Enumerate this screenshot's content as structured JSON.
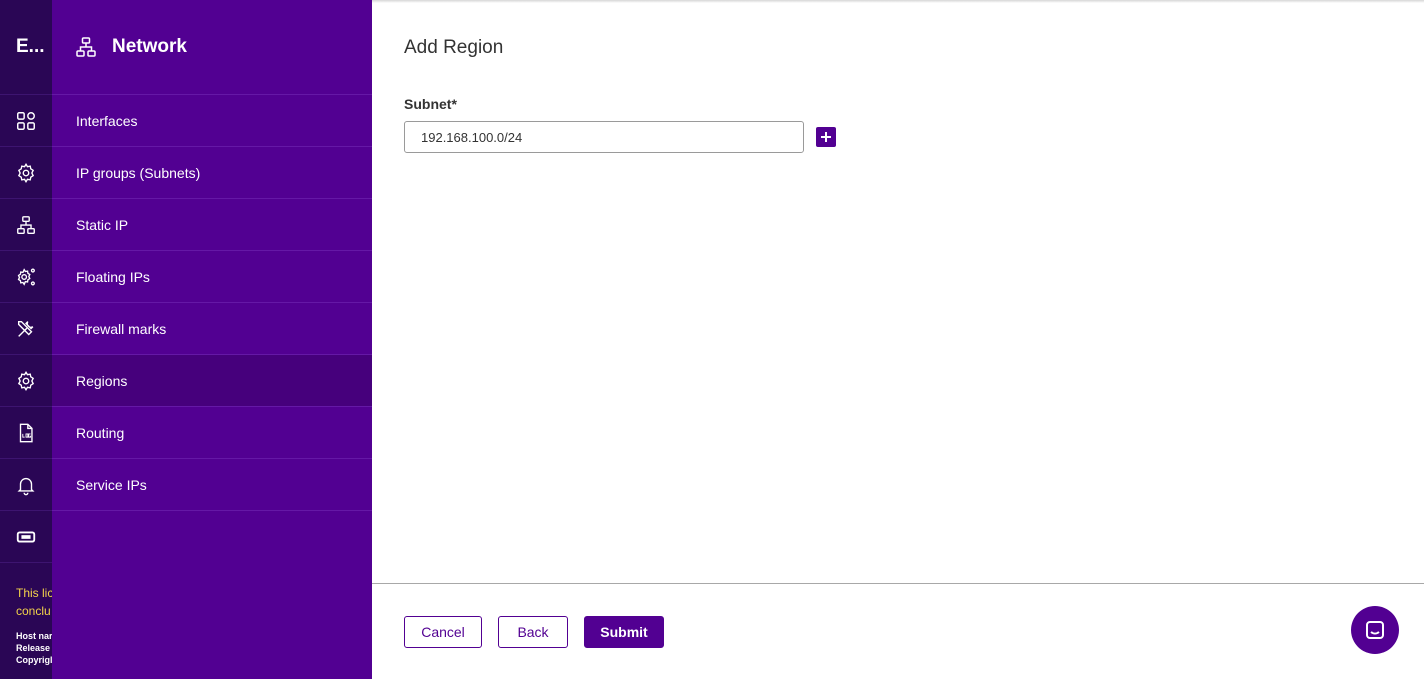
{
  "rail": {
    "brand": "E...",
    "items": [
      {
        "icon": "dashboard-grid-icon"
      },
      {
        "icon": "cog-network-icon"
      },
      {
        "icon": "network-icon"
      },
      {
        "icon": "settings-sliders-icon"
      },
      {
        "icon": "tools-icon"
      },
      {
        "icon": "gear-icon"
      },
      {
        "icon": "log-file-icon"
      },
      {
        "icon": "bell-icon"
      },
      {
        "icon": "ticket-icon"
      }
    ],
    "footer": {
      "warning_line1": "This lic",
      "warning_line2": "conclu",
      "host_label": "Host nar",
      "release_label": "Release",
      "copyright_label": "Copyrigl"
    }
  },
  "panel": {
    "title": "Network",
    "title_icon": "network-icon",
    "items": [
      {
        "label": "Interfaces",
        "active": false
      },
      {
        "label": "IP groups (Subnets)",
        "active": false
      },
      {
        "label": "Static IP",
        "active": false
      },
      {
        "label": "Floating IPs",
        "active": false
      },
      {
        "label": "Firewall marks",
        "active": false
      },
      {
        "label": "Regions",
        "active": true
      },
      {
        "label": "Routing",
        "active": false
      },
      {
        "label": "Service IPs",
        "active": false
      }
    ]
  },
  "main": {
    "title": "Add Region",
    "subnet": {
      "label": "Subnet*",
      "value": "192.168.100.0/24"
    },
    "buttons": {
      "cancel": "Cancel",
      "back": "Back",
      "submit": "Submit"
    }
  },
  "colors": {
    "primary": "#520092",
    "rail_bg": "#2a0655",
    "active_item": "#46007c",
    "warning": "#f3d34a"
  }
}
